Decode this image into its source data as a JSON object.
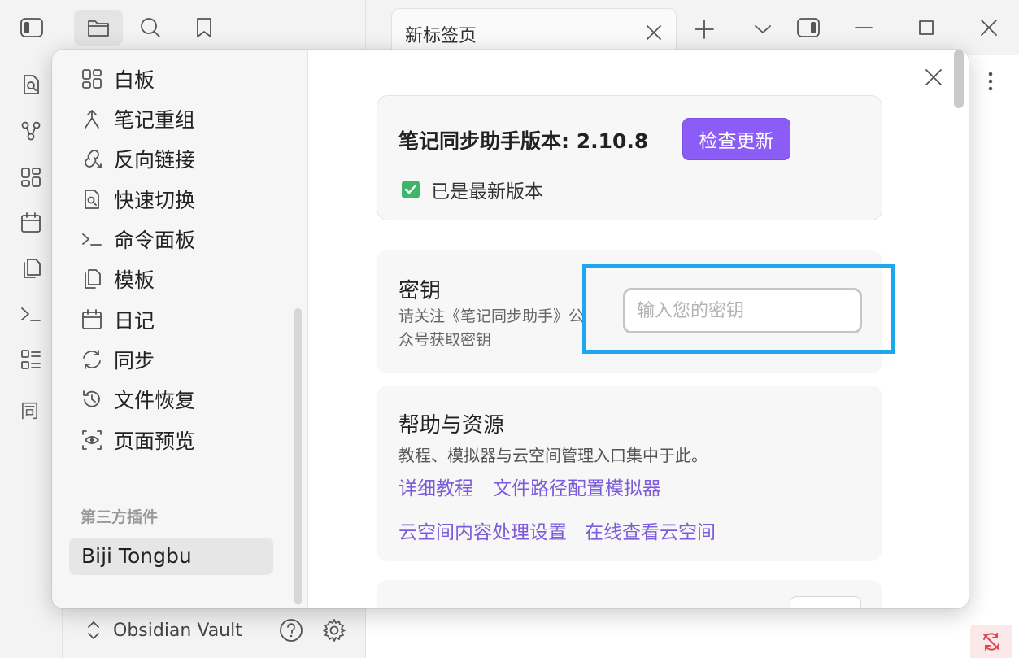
{
  "tab": {
    "title": "新标签页"
  },
  "vault": {
    "name": "Obsidian Vault"
  },
  "settings": {
    "sidebar_items": [
      {
        "label": "白板",
        "icon": "dashboard-icon"
      },
      {
        "label": "笔记重组",
        "icon": "merge-icon"
      },
      {
        "label": "反向链接",
        "icon": "backlink-icon"
      },
      {
        "label": "快速切换",
        "icon": "file-search-icon"
      },
      {
        "label": "命令面板",
        "icon": "terminal-icon"
      },
      {
        "label": "模板",
        "icon": "files-icon"
      },
      {
        "label": "日记",
        "icon": "calendar-icon"
      },
      {
        "label": "同步",
        "icon": "sync-icon"
      },
      {
        "label": "文件恢复",
        "icon": "history-icon"
      },
      {
        "label": "页面预览",
        "icon": "eye-icon"
      }
    ],
    "third_party_section": "第三方插件",
    "selected_plugin": "Biji Tongbu"
  },
  "plugin": {
    "version_label": "笔记同步助手版本: 2.10.8",
    "check_update_button": "检查更新",
    "status": "已是最新版本",
    "key": {
      "title": "密钥",
      "description": "请关注《笔记同步助手》公众号获取密钥",
      "placeholder": "输入您的密钥",
      "value": ""
    },
    "help": {
      "title": "帮助与资源",
      "description": "教程、模拟器与云空间管理入口集中于此。",
      "links": [
        "详细教程",
        "文件路径配置模拟器",
        "云空间内容处理设置",
        "在线查看云空间"
      ]
    }
  },
  "colors": {
    "accent": "#8b5cf6",
    "link": "#7c5cdb",
    "highlight": "#1ea7ef",
    "check": "#3fb56a"
  }
}
